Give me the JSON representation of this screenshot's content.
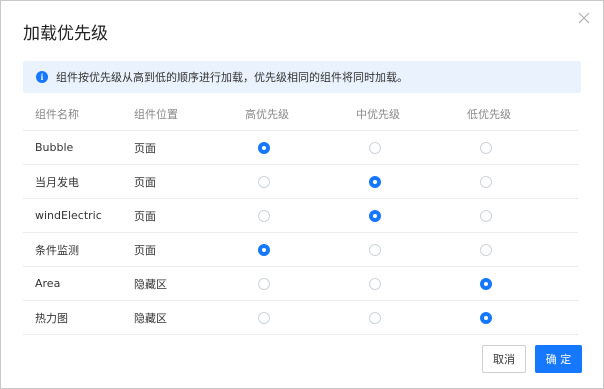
{
  "dialog": {
    "title": "加载优先级",
    "notice": "组件按优先级从高到低的顺序进行加载，优先级相同的组件将同时加载。"
  },
  "table": {
    "headers": [
      "组件名称",
      "组件位置",
      "高优先级",
      "中优先级",
      "低优先级"
    ],
    "rows": [
      {
        "name": "Bubble",
        "location": "页面",
        "priority": "high"
      },
      {
        "name": "当月发电",
        "location": "页面",
        "priority": "medium"
      },
      {
        "name": "windElectric",
        "location": "页面",
        "priority": "medium"
      },
      {
        "name": "条件监测",
        "location": "页面",
        "priority": "high"
      },
      {
        "name": "Area",
        "location": "隐藏区",
        "priority": "low"
      },
      {
        "name": "热力图",
        "location": "隐藏区",
        "priority": "low"
      }
    ]
  },
  "buttons": {
    "cancel": "取消",
    "ok": "确 定"
  },
  "colors": {
    "accent": "#1677ff",
    "notice_bg": "#eaf3fd"
  }
}
